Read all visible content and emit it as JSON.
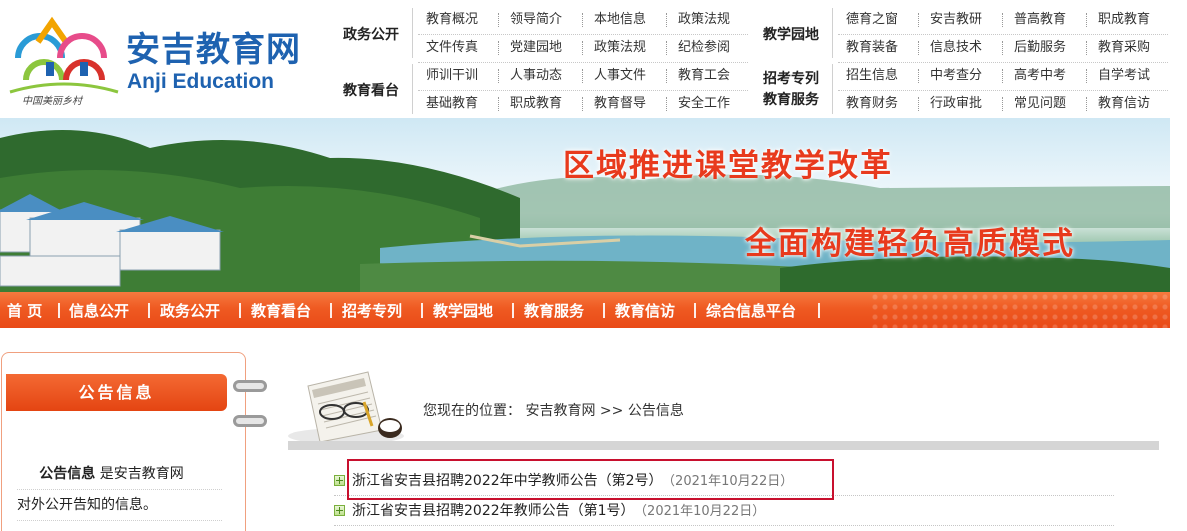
{
  "logo": {
    "title_cn": "安吉教育网",
    "title_en": "Anji Education",
    "subtitle": "中国美丽乡村"
  },
  "topnav": {
    "groups": [
      {
        "label": "政务公开",
        "links": [
          "教育概况",
          "领导简介",
          "本地信息",
          "政策法规",
          "文件传真",
          "党建园地",
          "政策法规",
          "纪检参阅"
        ]
      },
      {
        "label": "教育看台",
        "links": [
          "师训干训",
          "人事动态",
          "人事文件",
          "教育工会",
          "基础教育",
          "职成教育",
          "教育督导",
          "安全工作"
        ]
      },
      {
        "label": "教学园地",
        "links": [
          "德育之窗",
          "安吉教研",
          "普高教育",
          "职成教育",
          "教育装备",
          "信息技术",
          "后勤服务",
          "教育采购"
        ]
      },
      {
        "label": "招考专列",
        "label2": "教育服务",
        "links": [
          "招生信息",
          "中考查分",
          "高考中考",
          "自学考试",
          "教育财务",
          "行政审批",
          "常见问题",
          "教育信访"
        ]
      }
    ]
  },
  "banner": {
    "slogan_1": "区域推进课堂教学改革",
    "slogan_2": "全面构建轻负高质模式"
  },
  "mainnav": {
    "items": [
      "首 页",
      "信息公开",
      "政务公开",
      "教育看台",
      "招考专列",
      "教学园地",
      "教育服务",
      "教育信访",
      "综合信息平台"
    ]
  },
  "sidebar": {
    "title": "公告信息",
    "desc_highlight": "公告信息",
    "desc_rest_line1": " 是安吉教育网",
    "desc_line2": "对外公开告知的信息。"
  },
  "breadcrumb": {
    "prefix": "您现在的位置：",
    "home": "安吉教育网",
    "sep": ">>",
    "current": "公告信息"
  },
  "list": [
    {
      "title": "浙江省安吉县招聘2022年中学教师公告（第2号）",
      "date": "（2021年10月22日）"
    },
    {
      "title": "浙江省安吉县招聘2022年教师公告（第1号）",
      "date": "（2021年10月22日）"
    }
  ],
  "colors": {
    "brand_blue": "#1e62b0",
    "nav_orange": "#ef5a22",
    "slogan_red": "#e83a1d",
    "highlight_red": "#c8102e"
  }
}
